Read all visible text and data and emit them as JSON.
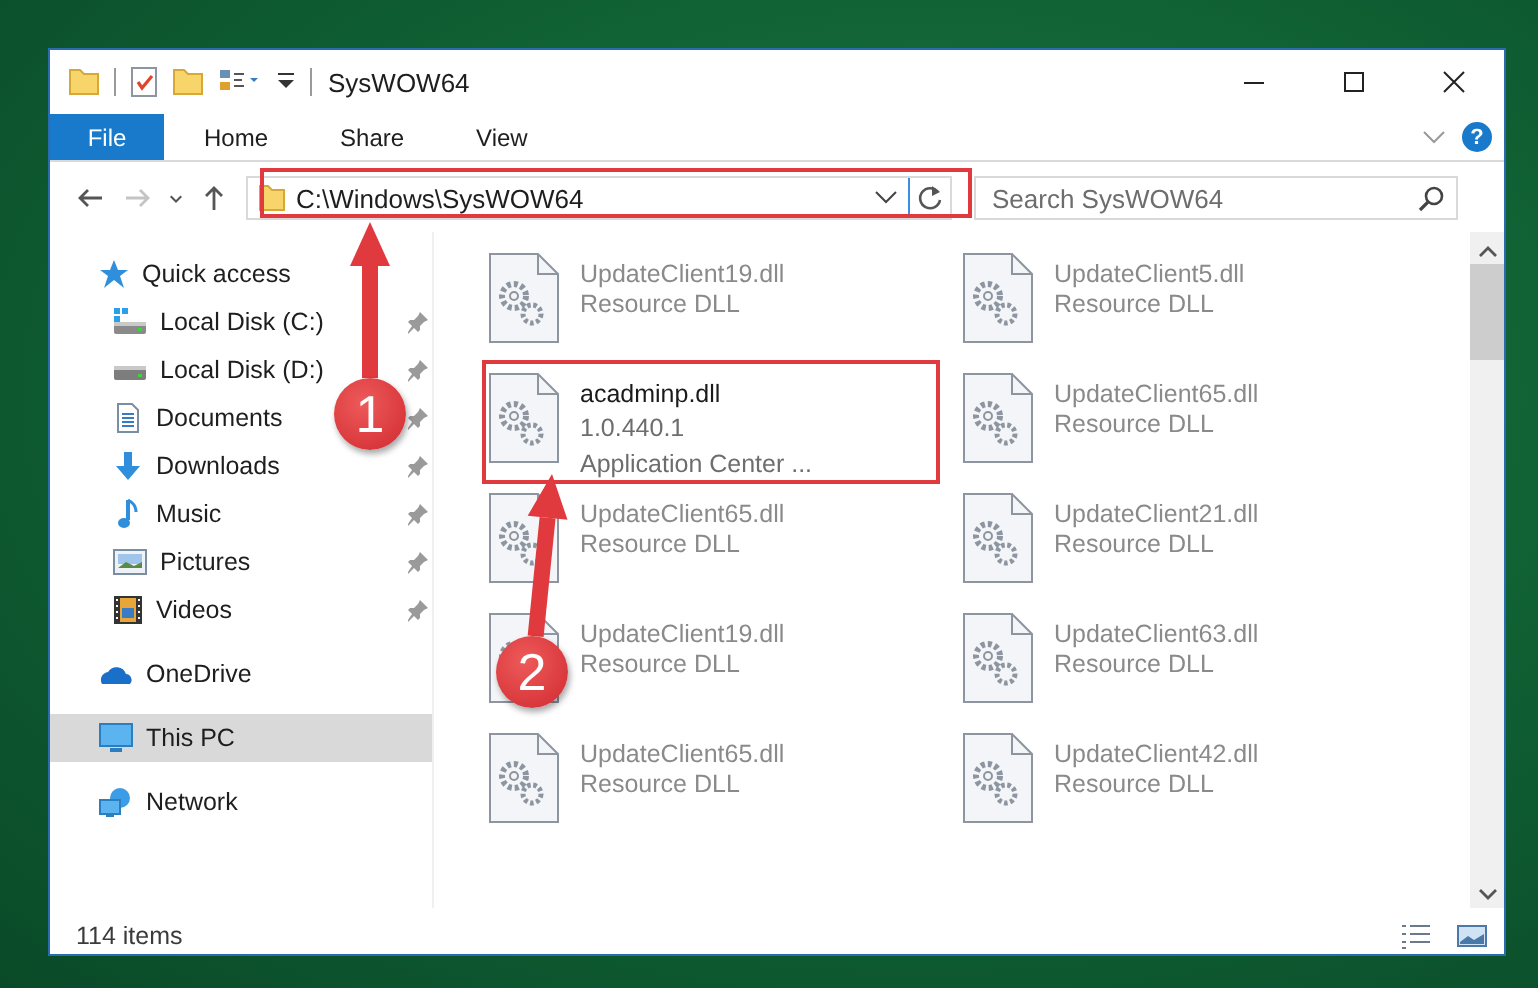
{
  "window": {
    "title": "SysWOW64"
  },
  "ribbon_tabs": [
    {
      "label": "File",
      "kind": "menu"
    },
    {
      "label": "Home",
      "kind": "tab"
    },
    {
      "label": "Share",
      "kind": "tab"
    },
    {
      "label": "View",
      "kind": "tab"
    }
  ],
  "help": "?",
  "navigation": [
    {
      "kind": "back",
      "disabled": false
    },
    {
      "kind": "forward",
      "disabled": true
    },
    {
      "kind": "recent",
      "disabled": false
    },
    {
      "kind": "up",
      "disabled": false
    }
  ],
  "address": {
    "path": "C:\\Windows\\SysWOW64"
  },
  "search": {
    "placeholder": "Search SysWOW64"
  },
  "sidebar": {
    "items": [
      {
        "label": "Quick access",
        "kind": "quick",
        "selected": false,
        "children": [
          {
            "label": "Local Disk (C:)",
            "kind": "system-drive",
            "pinned": true,
            "selected": false
          },
          {
            "label": "Local Disk (D:)",
            "kind": "drive",
            "pinned": true,
            "selected": false
          },
          {
            "label": "Documents",
            "kind": "documents",
            "pinned": true,
            "selected": false
          },
          {
            "label": "Downloads",
            "kind": "downloads",
            "pinned": true,
            "selected": false
          },
          {
            "label": "Music",
            "kind": "music",
            "pinned": true,
            "selected": false
          },
          {
            "label": "Pictures",
            "kind": "pictures",
            "pinned": true,
            "selected": false
          },
          {
            "label": "Videos",
            "kind": "videos",
            "pinned": true,
            "selected": false
          }
        ]
      },
      {
        "label": "OneDrive",
        "kind": "cloud",
        "selected": false
      },
      {
        "label": "This PC",
        "kind": "computer",
        "selected": true
      },
      {
        "label": "Network",
        "kind": "network",
        "selected": false
      }
    ]
  },
  "files": [
    {
      "name": "UpdateClient19.dll",
      "lines": [
        "Resource DLL"
      ],
      "blurred": true
    },
    {
      "name": "UpdateClient5.dll",
      "lines": [
        "Resource DLL"
      ],
      "blurred": true
    },
    {
      "name": "acadminp.dll",
      "lines": [
        "1.0.440.1",
        "Application Center ..."
      ],
      "blurred": false
    },
    {
      "name": "UpdateClient65.dll",
      "lines": [
        "Resource DLL"
      ],
      "blurred": true
    },
    {
      "name": "UpdateClient65.dll",
      "lines": [
        "Resource DLL"
      ],
      "blurred": true
    },
    {
      "name": "UpdateClient21.dll",
      "lines": [
        "Resource DLL"
      ],
      "blurred": true
    },
    {
      "name": "UpdateClient19.dll",
      "lines": [
        "Resource DLL"
      ],
      "blurred": true
    },
    {
      "name": "UpdateClient63.dll",
      "lines": [
        "Resource DLL"
      ],
      "blurred": true
    },
    {
      "name": "UpdateClient65.dll",
      "lines": [
        "Resource DLL"
      ],
      "blurred": true
    },
    {
      "name": "UpdateClient42.dll",
      "lines": [
        "Resource DLL"
      ],
      "blurred": true
    }
  ],
  "status_bar": {
    "text": "114 items"
  },
  "callouts": [
    {
      "label": "1"
    },
    {
      "label": "2"
    }
  ]
}
